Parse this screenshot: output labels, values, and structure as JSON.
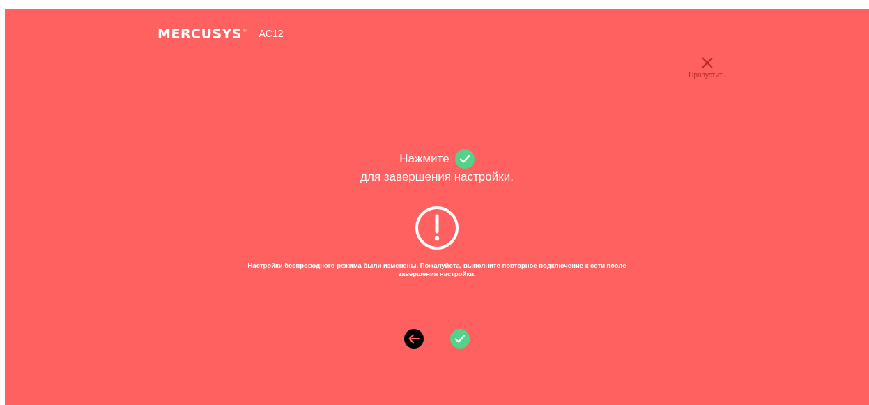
{
  "header": {
    "brand": "MERCUSYS",
    "registered_mark": "®",
    "model": "AC12"
  },
  "skip": {
    "label": "Пропустить"
  },
  "instruction": {
    "line_1": "Нажмите",
    "line_2": "для завершения настройки."
  },
  "notice": {
    "text": "Настройки беспроводного режима были изменены. Пожалуйста, выполните повторное подключение к сети после завершения настройки."
  },
  "actions": [
    {
      "kind": "back"
    },
    {
      "kind": "confirm"
    }
  ]
}
